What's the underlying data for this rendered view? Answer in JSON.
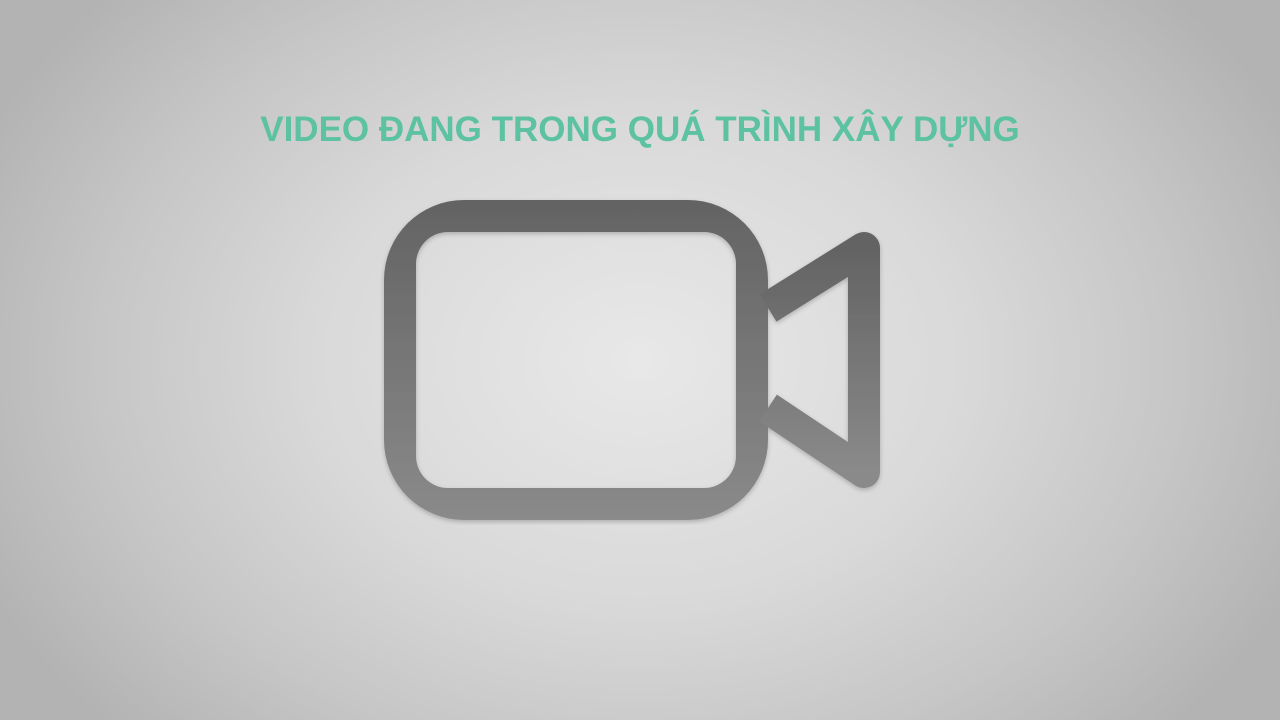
{
  "title": "VIDEO ĐANG TRONG QUÁ TRÌNH XÂY DỰNG",
  "icon": "video-camera-icon",
  "colors": {
    "title": "#5cc2a1",
    "icon_stroke_light": "#8a8a8a",
    "icon_stroke_dark": "#636363",
    "background_center": "#e8e8e8",
    "background_edge": "#b3b3b3"
  }
}
